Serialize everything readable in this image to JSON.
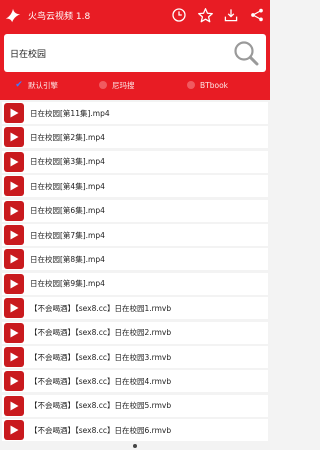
{
  "app": {
    "title": "火鸟云视频 1.8",
    "accent_color": "#e81c24"
  },
  "toolbar": {
    "actions": [
      {
        "icon": "clock-icon",
        "label": "history"
      },
      {
        "icon": "star-icon",
        "label": "favorites"
      },
      {
        "icon": "download-icon",
        "label": "download"
      },
      {
        "icon": "share-icon",
        "label": "share"
      }
    ]
  },
  "search": {
    "value": "日在校园",
    "icon": "search-icon"
  },
  "engines": [
    {
      "label": "默认引擎",
      "checked": true
    },
    {
      "label": "尼玛搜",
      "checked": false
    },
    {
      "label": "BTbook",
      "checked": false
    }
  ],
  "results": [
    "日在校园[第11集].mp4",
    "日在校园[第2集].mp4",
    "日在校园[第3集].mp4",
    "日在校园[第4集].mp4",
    "日在校园[第6集].mp4",
    "日在校园[第7集].mp4",
    "日在校园[第8集].mp4",
    "日在校园[第9集].mp4",
    "【不会喝酒】【sex8.cc】日在校园1.rmvb",
    "【不会喝酒】【sex8.cc】日在校园2.rmvb",
    "【不会喝酒】【sex8.cc】日在校园3.rmvb",
    "【不会喝酒】【sex8.cc】日在校园4.rmvb",
    "【不会喝酒】【sex8.cc】日在校园5.rmvb",
    "【不会喝酒】【sex8.cc】日在校园6.rmvb"
  ]
}
